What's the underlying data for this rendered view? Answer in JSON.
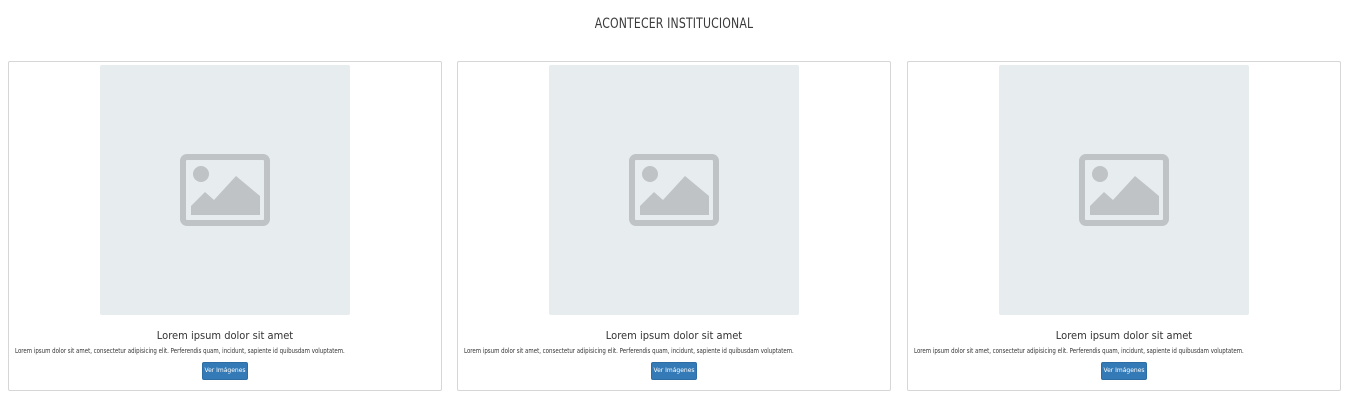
{
  "section": {
    "title": "ACONTECER INSTITUCIONAL"
  },
  "placeholder_icon": "image-placeholder-icon",
  "colors": {
    "thumb_bg": "#e7ecef",
    "icon": "#bfc3c5",
    "button": "#337ab7",
    "card_border": "#d6d6d6"
  },
  "cards": [
    {
      "title": "Lorem ipsum dolor sit amet",
      "text": "Lorem ipsum dolor sit amet, consectetur adipisicing elit. Perferendis quam, incidunt, sapiente id quibusdam voluptatem.",
      "button_label": "Ver Imágenes"
    },
    {
      "title": "Lorem ipsum dolor sit amet",
      "text": "Lorem ipsum dolor sit amet, consectetur adipisicing elit. Perferendis quam, incidunt, sapiente id quibusdam voluptatem.",
      "button_label": "Ver Imágenes"
    },
    {
      "title": "Lorem ipsum dolor sit amet",
      "text": "Lorem ipsum dolor sit amet, consectetur adipisicing elit. Perferendis quam, incidunt, sapiente id quibusdam voluptatem.",
      "button_label": "Ver Imágenes"
    }
  ]
}
